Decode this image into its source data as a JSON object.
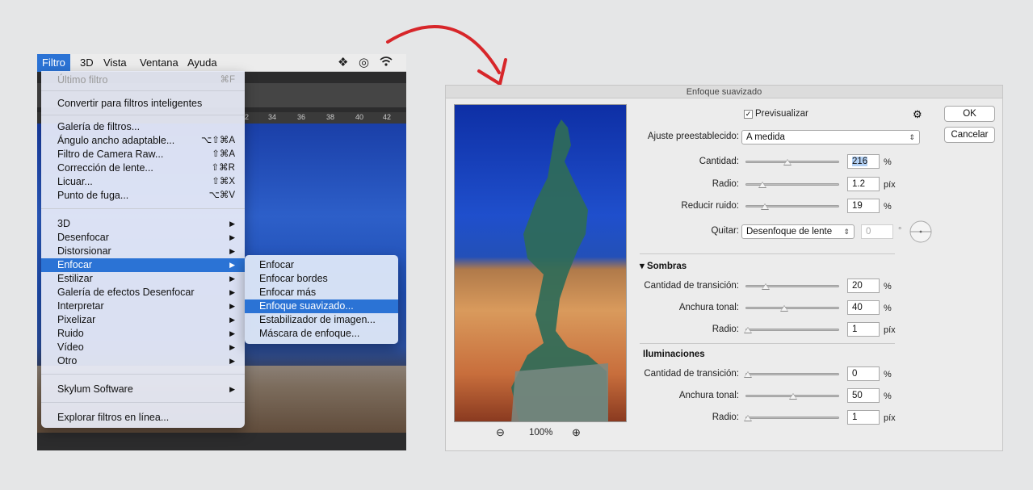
{
  "menubar": {
    "items": [
      "Filtro",
      "3D",
      "Vista",
      "Ventana",
      "Ayuda"
    ],
    "icons": [
      "dropbox-icon",
      "creative-cloud-icon",
      "wifi-icon"
    ]
  },
  "ruler": [
    "2",
    "34",
    "36",
    "38",
    "40",
    "42"
  ],
  "filter_menu": {
    "last_filter": {
      "label": "Último filtro",
      "shortcut": "⌘F"
    },
    "convert": "Convertir para filtros inteligentes",
    "group1": [
      {
        "label": "Galería de filtros...",
        "shortcut": ""
      },
      {
        "label": "Ángulo ancho adaptable...",
        "shortcut": "⌥⇧⌘A"
      },
      {
        "label": "Filtro de Camera Raw...",
        "shortcut": "⇧⌘A"
      },
      {
        "label": "Corrección de lente...",
        "shortcut": "⇧⌘R"
      },
      {
        "label": "Licuar...",
        "shortcut": "⇧⌘X"
      },
      {
        "label": "Punto de fuga...",
        "shortcut": "⌥⌘V"
      }
    ],
    "group2": [
      "3D",
      "Desenfocar",
      "Distorsionar",
      "Enfocar",
      "Estilizar",
      "Galería de efectos Desenfocar",
      "Interpretar",
      "Pixelizar",
      "Ruido",
      "Vídeo",
      "Otro"
    ],
    "skylum": "Skylum Software",
    "browse": "Explorar filtros en línea..."
  },
  "submenu": [
    "Enfocar",
    "Enfocar bordes",
    "Enfocar más",
    "Enfoque suavizado...",
    "Estabilizador de imagen...",
    "Máscara de enfoque..."
  ],
  "dialog": {
    "title": "Enfoque suavizado",
    "preview_label": "Previsualizar",
    "ok": "OK",
    "cancel": "Cancelar",
    "preset_label": "Ajuste preestablecido:",
    "preset_value": "A medida",
    "amount": {
      "label": "Cantidad:",
      "value": "216",
      "unit": "%",
      "level": 0.45
    },
    "radius": {
      "label": "Radio:",
      "value": "1.2",
      "unit": "píx",
      "level": 0.15
    },
    "noise": {
      "label": "Reducir ruido:",
      "value": "19",
      "unit": "%",
      "level": 0.19
    },
    "remove": {
      "label": "Quitar:",
      "value": "Desenfoque de lente",
      "angle": "0",
      "deg": "°"
    },
    "zoom": "100%",
    "shadows": {
      "title": "Sombras",
      "fade": {
        "label": "Cantidad de transición:",
        "value": "20",
        "unit": "%",
        "level": 0.2
      },
      "tonal": {
        "label": "Anchura tonal:",
        "value": "40",
        "unit": "%",
        "level": 0.4
      },
      "radius": {
        "label": "Radio:",
        "value": "1",
        "unit": "píx",
        "level": 0.0
      }
    },
    "highlights": {
      "title": "Iluminaciones",
      "fade": {
        "label": "Cantidad de transición:",
        "value": "0",
        "unit": "%",
        "level": 0.0
      },
      "tonal": {
        "label": "Anchura tonal:",
        "value": "50",
        "unit": "%",
        "level": 0.5
      },
      "radius": {
        "label": "Radio:",
        "value": "1",
        "unit": "píx",
        "level": 0.0
      }
    }
  }
}
